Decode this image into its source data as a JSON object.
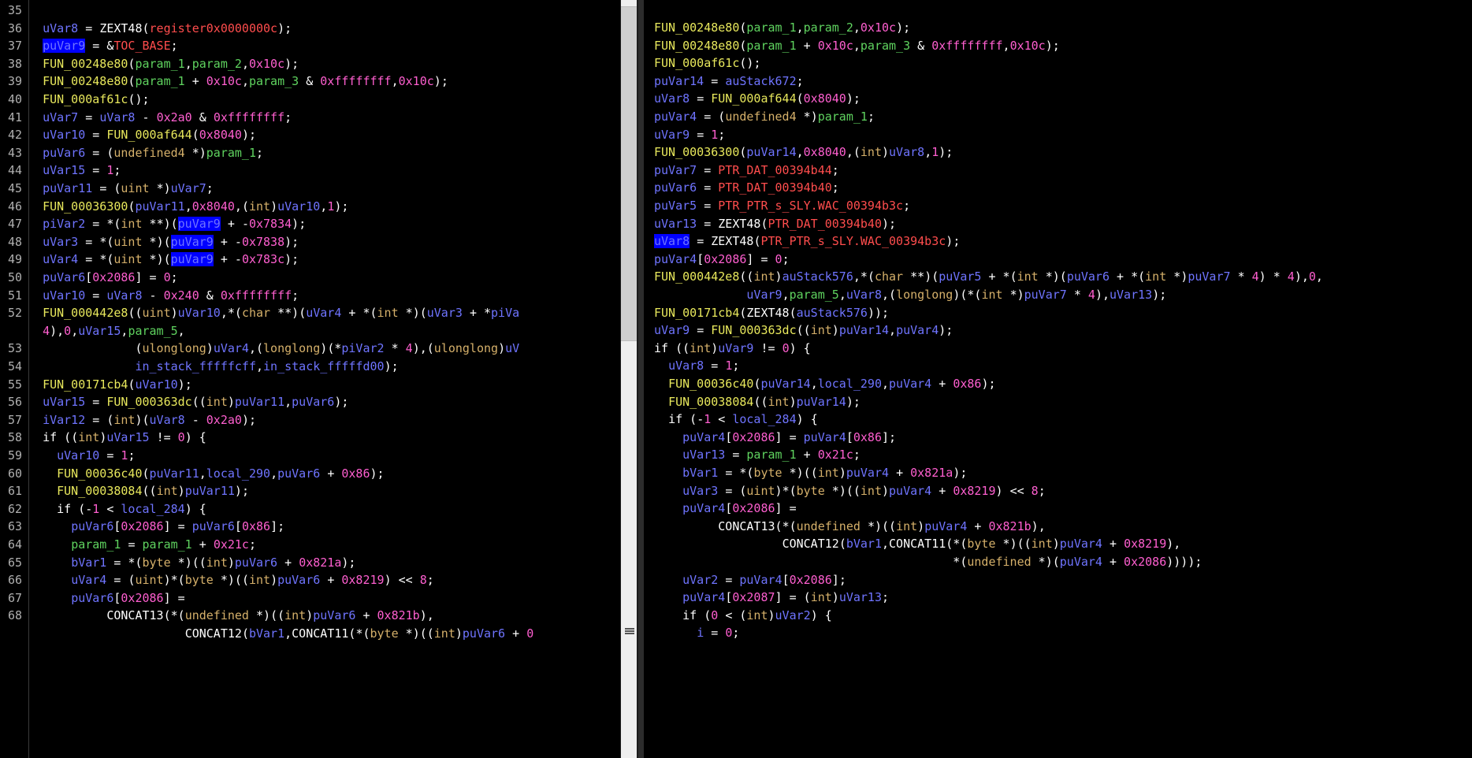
{
  "left_pane": {
    "lines": [
      {
        "num": "35",
        "code": ""
      },
      {
        "num": "36",
        "code": "  uVar8 = ZEXT48(register0x0000000c);"
      },
      {
        "num": "37",
        "code": "  puVar9 = &TOC_BASE;"
      },
      {
        "num": "38",
        "code": "  FUN_00248e80(param_1,param_2,0x10c);"
      },
      {
        "num": "39",
        "code": "  FUN_00248e80(param_1 + 0x10c,param_3 & 0xffffffff,0x10c);"
      },
      {
        "num": "40",
        "code": "  FUN_000af61c();"
      },
      {
        "num": "41",
        "code": "  uVar7 = uVar8 - 0x2a0 & 0xffffffff;"
      },
      {
        "num": "42",
        "code": "  uVar10 = FUN_000af644(0x8040);"
      },
      {
        "num": "43",
        "code": "  puVar6 = (undefined4 *)param_1;"
      },
      {
        "num": "44",
        "code": "  uVar15 = 1;"
      },
      {
        "num": "45",
        "code": "  puVar11 = (uint *)uVar7;"
      },
      {
        "num": "46",
        "code": "  FUN_00036300(puVar11,0x8040,(int)uVar10,1);"
      },
      {
        "num": "47",
        "code": "  piVar2 = *(int **)(puVar9 + -0x7834);"
      },
      {
        "num": "48",
        "code": "  uVar3 = *(uint *)(puVar9 + -0x7838);"
      },
      {
        "num": "49",
        "code": "  uVar4 = *(uint *)(puVar9 + -0x783c);"
      },
      {
        "num": "50",
        "code": "  puVar6[0x2086] = 0;"
      },
      {
        "num": "51",
        "code": "  uVar10 = uVar8 - 0x240 & 0xffffffff;"
      },
      {
        "num": "52",
        "code": "  FUN_000442e8((uint)uVar10,*(char **)(uVar4 + *(int *)(uVar3 + *piVa"
      },
      {
        "num": "",
        "code": "  4),0,uVar15,param_5,"
      },
      {
        "num": "53",
        "code": "               (ulonglong)uVar4,(longlong)(*piVar2 * 4),(ulonglong)uV"
      },
      {
        "num": "54",
        "code": "               in_stack_fffffcff,in_stack_fffffd00);"
      },
      {
        "num": "55",
        "code": "  FUN_00171cb4(uVar10);"
      },
      {
        "num": "56",
        "code": "  uVar15 = FUN_000363dc((int)puVar11,puVar6);"
      },
      {
        "num": "57",
        "code": "  iVar12 = (int)(uVar8 - 0x2a0);"
      },
      {
        "num": "58",
        "code": "  if ((int)uVar15 != 0) {"
      },
      {
        "num": "59",
        "code": "    uVar10 = 1;"
      },
      {
        "num": "60",
        "code": "    FUN_00036c40(puVar11,local_290,puVar6 + 0x86);"
      },
      {
        "num": "61",
        "code": "    FUN_00038084((int)puVar11);"
      },
      {
        "num": "62",
        "code": "    if (-1 < local_284) {"
      },
      {
        "num": "63",
        "code": "      puVar6[0x2086] = puVar6[0x86];"
      },
      {
        "num": "64",
        "code": "      param_1 = param_1 + 0x21c;"
      },
      {
        "num": "65",
        "code": "      bVar1 = *(byte *)((int)puVar6 + 0x821a);"
      },
      {
        "num": "66",
        "code": "      uVar4 = (uint)*(byte *)((int)puVar6 + 0x8219) << 8;"
      },
      {
        "num": "67",
        "code": "      puVar6[0x2086] ="
      },
      {
        "num": "68",
        "code": "           CONCAT13(*(undefined *)((int)puVar6 + 0x821b),"
      },
      {
        "num": "",
        "code": "                      CONCAT12(bVar1,CONCAT11(*(byte *)((int)puVar6 + 0"
      }
    ]
  },
  "right_pane": {
    "lines": [
      {
        "code": "FUN_00248e80(param_1,param_2,0x10c);"
      },
      {
        "code": "FUN_00248e80(param_1 + 0x10c,param_3 & 0xffffffff,0x10c);"
      },
      {
        "code": "FUN_000af61c();"
      },
      {
        "code": "puVar14 = auStack672;"
      },
      {
        "code": "uVar8 = FUN_000af644(0x8040);"
      },
      {
        "code": "puVar4 = (undefined4 *)param_1;"
      },
      {
        "code": "uVar9 = 1;"
      },
      {
        "code": "FUN_00036300(puVar14,0x8040,(int)uVar8,1);"
      },
      {
        "code": "puVar7 = PTR_DAT_00394b44;"
      },
      {
        "code": "puVar6 = PTR_DAT_00394b40;"
      },
      {
        "code": "puVar5 = PTR_PTR_s_SLY.WAC_00394b3c;"
      },
      {
        "code": "uVar13 = ZEXT48(PTR_DAT_00394b40);"
      },
      {
        "code": "uVar8 = ZEXT48(PTR_PTR_s_SLY.WAC_00394b3c);"
      },
      {
        "code": "puVar4[0x2086] = 0;"
      },
      {
        "code": "FUN_000442e8((int)auStack576,*(char **)(puVar5 + *(int *)(puVar6 + *(int *)puVar7 * 4) * 4),0,"
      },
      {
        "code": "             uVar9,param_5,uVar8,(longlong)(*(int *)puVar7 * 4),uVar13);"
      },
      {
        "code": "FUN_00171cb4(ZEXT48(auStack576));"
      },
      {
        "code": "uVar9 = FUN_000363dc((int)puVar14,puVar4);"
      },
      {
        "code": "if ((int)uVar9 != 0) {"
      },
      {
        "code": "  uVar8 = 1;"
      },
      {
        "code": "  FUN_00036c40(puVar14,local_290,puVar4 + 0x86);"
      },
      {
        "code": "  FUN_00038084((int)puVar14);"
      },
      {
        "code": "  if (-1 < local_284) {"
      },
      {
        "code": "    puVar4[0x2086] = puVar4[0x86];"
      },
      {
        "code": "    uVar13 = param_1 + 0x21c;"
      },
      {
        "code": "    bVar1 = *(byte *)((int)puVar4 + 0x821a);"
      },
      {
        "code": "    uVar3 = (uint)*(byte *)((int)puVar4 + 0x8219) << 8;"
      },
      {
        "code": "    puVar4[0x2086] ="
      },
      {
        "code": "         CONCAT13(*(undefined *)((int)puVar4 + 0x821b),"
      },
      {
        "code": "                  CONCAT12(bVar1,CONCAT11(*(byte *)((int)puVar4 + 0x8219),"
      },
      {
        "code": "                                          *(undefined *)(puVar4 + 0x2086))));"
      },
      {
        "code": "    uVar2 = puVar4[0x2086];"
      },
      {
        "code": "    puVar4[0x2087] = (int)uVar13;"
      },
      {
        "code": "    if (0 < (int)uVar2) {"
      },
      {
        "code": "      i = 0;"
      }
    ]
  },
  "highlight_token": "puVar9",
  "right_highlight_token": "uVar8",
  "colors": {
    "background": "#000000",
    "variable": "#6f74ff",
    "function": "#e8e85c",
    "parameter": "#5fd35f",
    "number": "#ff5fd0",
    "type": "#d5b06a",
    "global": "#ff4d4d",
    "selection": "#0000ff"
  }
}
